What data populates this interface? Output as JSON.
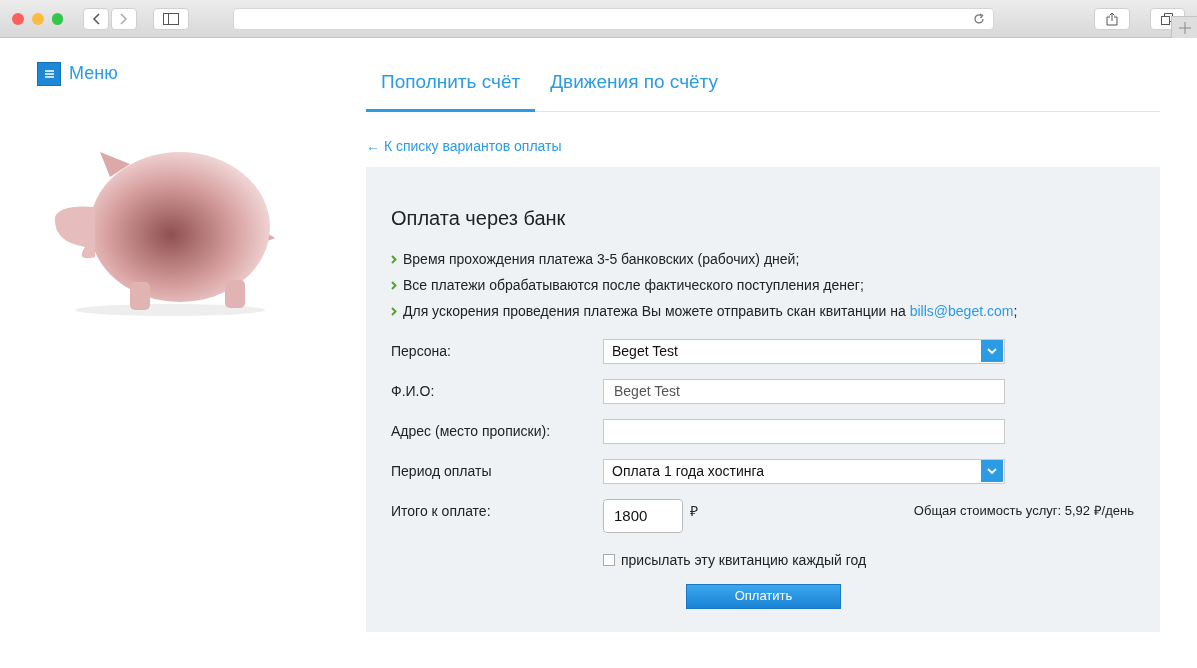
{
  "menu": {
    "label": "Меню"
  },
  "tabs": [
    {
      "label": "Пополнить счёт",
      "selected": true
    },
    {
      "label": "Движения по счёту",
      "selected": false
    }
  ],
  "back_link": "← К списку вариантов оплаты",
  "panel": {
    "title": "Оплата через банк",
    "notes": [
      {
        "text": "Время прохождения платежа 3-5 банковских (рабочих) дней;"
      },
      {
        "text": "Все платежи обрабатываются после фактического поступления денег;"
      },
      {
        "text": "Для ускорения проведения платежа Вы можете отправить скан квитанции на",
        "link": "bills@beget.com",
        "tail": ";"
      }
    ],
    "fields": [
      {
        "kind": "select",
        "label": "Персона:",
        "value": "Beget Test"
      },
      {
        "kind": "input",
        "label": "Ф.И.О:",
        "value": "Beget Test"
      },
      {
        "kind": "input",
        "label": "Адрес (место прописки):"
      },
      {
        "kind": "select",
        "label": "Период оплаты",
        "value": "Оплата 1 года хостинга"
      }
    ],
    "total": {
      "label": "Итого к оплате:",
      "value": "1800",
      "currency": "₽",
      "daily_cost": "Общая стоимость услуг: 5,92 ₽/день"
    },
    "yearly_checkbox": {
      "label": "присылать эту квитанцию каждый год",
      "checked": false
    },
    "pay_button": "Оплатить"
  }
}
